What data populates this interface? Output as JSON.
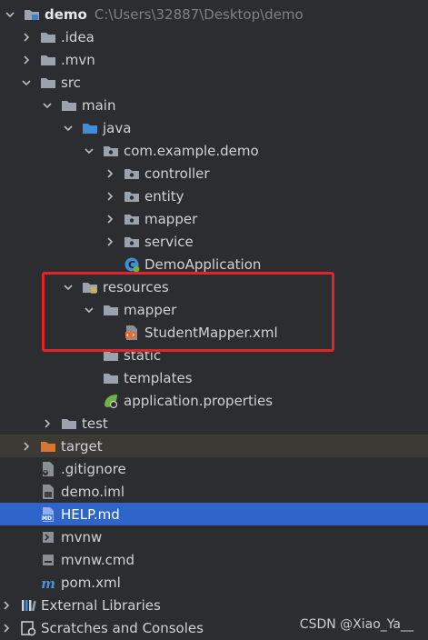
{
  "tree": {
    "items": [
      {
        "label": "demo",
        "path": "C:\\Users\\32887\\Desktop\\demo",
        "icon": "module-folder-icon",
        "arrow": "down"
      },
      {
        "label": ".idea",
        "icon": "folder-icon",
        "arrow": "right"
      },
      {
        "label": ".mvn",
        "icon": "folder-icon",
        "arrow": "right"
      },
      {
        "label": "src",
        "icon": "folder-icon",
        "arrow": "down"
      },
      {
        "label": "main",
        "icon": "folder-icon",
        "arrow": "down"
      },
      {
        "label": "java",
        "icon": "source-folder-icon",
        "arrow": "down"
      },
      {
        "label": "com.example.demo",
        "icon": "package-icon",
        "arrow": "down"
      },
      {
        "label": "controller",
        "icon": "package-icon",
        "arrow": "right"
      },
      {
        "label": "entity",
        "icon": "package-icon",
        "arrow": "right"
      },
      {
        "label": "mapper",
        "icon": "package-icon",
        "arrow": "right"
      },
      {
        "label": "service",
        "icon": "package-icon",
        "arrow": "right"
      },
      {
        "label": "DemoApplication",
        "icon": "spring-class-icon",
        "arrow": "none"
      },
      {
        "label": "resources",
        "icon": "resources-folder-icon",
        "arrow": "down"
      },
      {
        "label": "mapper",
        "icon": "folder-icon",
        "arrow": "down"
      },
      {
        "label": "StudentMapper.xml",
        "icon": "xml-file-icon",
        "arrow": "none"
      },
      {
        "label": "static",
        "icon": "folder-icon",
        "arrow": "none"
      },
      {
        "label": "templates",
        "icon": "folder-icon",
        "arrow": "none"
      },
      {
        "label": "application.properties",
        "icon": "spring-properties-icon",
        "arrow": "none"
      },
      {
        "label": "test",
        "icon": "folder-icon",
        "arrow": "right"
      },
      {
        "label": "target",
        "icon": "excluded-folder-icon",
        "arrow": "right"
      },
      {
        "label": ".gitignore",
        "icon": "gitignore-file-icon",
        "arrow": "none"
      },
      {
        "label": "demo.iml",
        "icon": "iml-file-icon",
        "arrow": "none"
      },
      {
        "label": "HELP.md",
        "icon": "markdown-file-icon",
        "arrow": "none"
      },
      {
        "label": "mvnw",
        "icon": "shell-file-icon",
        "arrow": "none"
      },
      {
        "label": "mvnw.cmd",
        "icon": "cmd-file-icon",
        "arrow": "none"
      },
      {
        "label": "pom.xml",
        "icon": "maven-pom-icon",
        "arrow": "none"
      },
      {
        "label": "External Libraries",
        "icon": "libraries-icon",
        "arrow": "right"
      },
      {
        "label": "Scratches and Consoles",
        "icon": "scratches-icon",
        "arrow": "right"
      }
    ]
  },
  "watermark": "CSDN @Xiao_Ya__",
  "colors": {
    "background": "#2b2d30",
    "selection": "#2f65ca",
    "highlight_box": "#e2242a",
    "excluded_row": "#3b3a35"
  }
}
